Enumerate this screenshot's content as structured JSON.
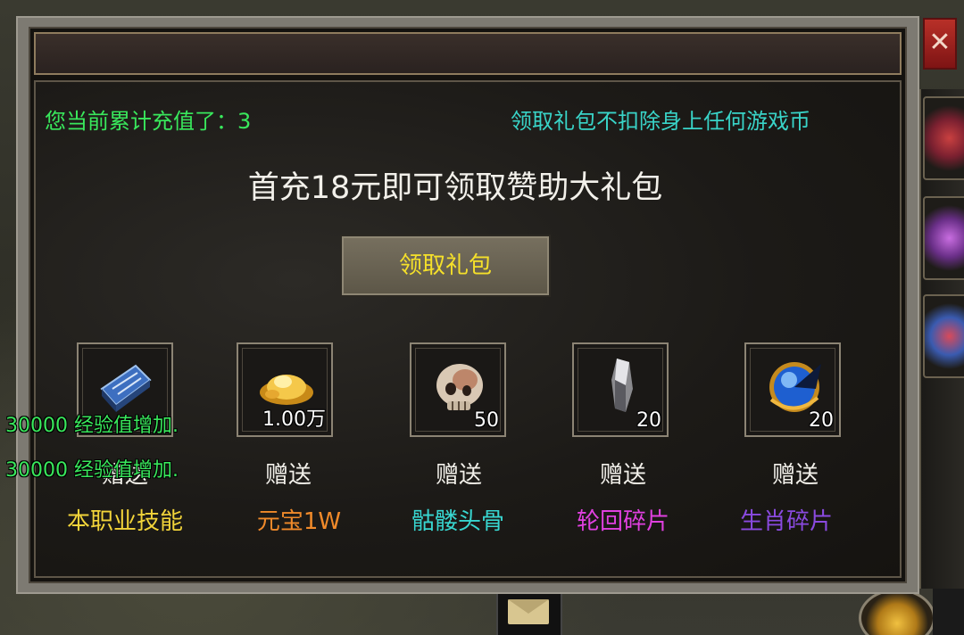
{
  "close_label": "✕",
  "recharge": {
    "label": "您当前累计充值了：",
    "amount": "3"
  },
  "notice": "领取礼包不扣除身上任何游戏币",
  "title": "首充18元即可领取赞助大礼包",
  "claim_button": "领取礼包",
  "rewards": [
    {
      "icon": "skill-book-icon",
      "quantity": "",
      "gift": "赠送",
      "name": "本职业技能",
      "name_color": "#f2d43a"
    },
    {
      "icon": "gold-ingot-icon",
      "quantity": "1.00万",
      "gift": "赠送",
      "name": "元宝1W",
      "name_color": "#f08a2a"
    },
    {
      "icon": "skull-icon",
      "quantity": "50",
      "gift": "赠送",
      "name": "骷髅头骨",
      "name_color": "#38d6d0"
    },
    {
      "icon": "crystal-shard-icon",
      "quantity": "20",
      "gift": "赠送",
      "name": "轮回碎片",
      "name_color": "#e040e0"
    },
    {
      "icon": "zodiac-orb-icon",
      "quantity": "20",
      "gift": "赠送",
      "name": "生肖碎片",
      "name_color": "#8a4ae0"
    }
  ],
  "system_messages": [
    "30000 经验值增加.",
    "30000 经验值增加."
  ],
  "colors": {
    "recharge_text": "#39e85c",
    "notice_text": "#39d4c8",
    "claim_text": "#f5e02a"
  }
}
